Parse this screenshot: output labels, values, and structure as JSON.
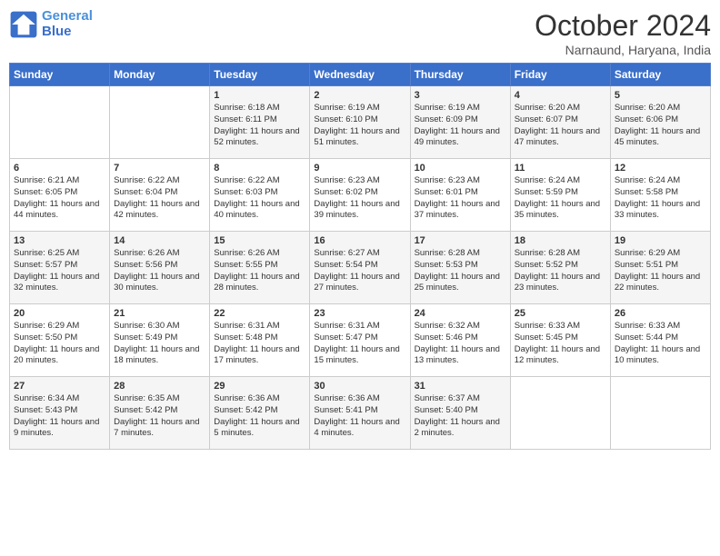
{
  "header": {
    "logo_line1": "General",
    "logo_line2": "Blue",
    "month": "October 2024",
    "location": "Narnaund, Haryana, India"
  },
  "days_of_week": [
    "Sunday",
    "Monday",
    "Tuesday",
    "Wednesday",
    "Thursday",
    "Friday",
    "Saturday"
  ],
  "weeks": [
    [
      {
        "day": "",
        "sunrise": "",
        "sunset": "",
        "daylight": ""
      },
      {
        "day": "",
        "sunrise": "",
        "sunset": "",
        "daylight": ""
      },
      {
        "day": "1",
        "sunrise": "Sunrise: 6:18 AM",
        "sunset": "Sunset: 6:11 PM",
        "daylight": "Daylight: 11 hours and 52 minutes."
      },
      {
        "day": "2",
        "sunrise": "Sunrise: 6:19 AM",
        "sunset": "Sunset: 6:10 PM",
        "daylight": "Daylight: 11 hours and 51 minutes."
      },
      {
        "day": "3",
        "sunrise": "Sunrise: 6:19 AM",
        "sunset": "Sunset: 6:09 PM",
        "daylight": "Daylight: 11 hours and 49 minutes."
      },
      {
        "day": "4",
        "sunrise": "Sunrise: 6:20 AM",
        "sunset": "Sunset: 6:07 PM",
        "daylight": "Daylight: 11 hours and 47 minutes."
      },
      {
        "day": "5",
        "sunrise": "Sunrise: 6:20 AM",
        "sunset": "Sunset: 6:06 PM",
        "daylight": "Daylight: 11 hours and 45 minutes."
      }
    ],
    [
      {
        "day": "6",
        "sunrise": "Sunrise: 6:21 AM",
        "sunset": "Sunset: 6:05 PM",
        "daylight": "Daylight: 11 hours and 44 minutes."
      },
      {
        "day": "7",
        "sunrise": "Sunrise: 6:22 AM",
        "sunset": "Sunset: 6:04 PM",
        "daylight": "Daylight: 11 hours and 42 minutes."
      },
      {
        "day": "8",
        "sunrise": "Sunrise: 6:22 AM",
        "sunset": "Sunset: 6:03 PM",
        "daylight": "Daylight: 11 hours and 40 minutes."
      },
      {
        "day": "9",
        "sunrise": "Sunrise: 6:23 AM",
        "sunset": "Sunset: 6:02 PM",
        "daylight": "Daylight: 11 hours and 39 minutes."
      },
      {
        "day": "10",
        "sunrise": "Sunrise: 6:23 AM",
        "sunset": "Sunset: 6:01 PM",
        "daylight": "Daylight: 11 hours and 37 minutes."
      },
      {
        "day": "11",
        "sunrise": "Sunrise: 6:24 AM",
        "sunset": "Sunset: 5:59 PM",
        "daylight": "Daylight: 11 hours and 35 minutes."
      },
      {
        "day": "12",
        "sunrise": "Sunrise: 6:24 AM",
        "sunset": "Sunset: 5:58 PM",
        "daylight": "Daylight: 11 hours and 33 minutes."
      }
    ],
    [
      {
        "day": "13",
        "sunrise": "Sunrise: 6:25 AM",
        "sunset": "Sunset: 5:57 PM",
        "daylight": "Daylight: 11 hours and 32 minutes."
      },
      {
        "day": "14",
        "sunrise": "Sunrise: 6:26 AM",
        "sunset": "Sunset: 5:56 PM",
        "daylight": "Daylight: 11 hours and 30 minutes."
      },
      {
        "day": "15",
        "sunrise": "Sunrise: 6:26 AM",
        "sunset": "Sunset: 5:55 PM",
        "daylight": "Daylight: 11 hours and 28 minutes."
      },
      {
        "day": "16",
        "sunrise": "Sunrise: 6:27 AM",
        "sunset": "Sunset: 5:54 PM",
        "daylight": "Daylight: 11 hours and 27 minutes."
      },
      {
        "day": "17",
        "sunrise": "Sunrise: 6:28 AM",
        "sunset": "Sunset: 5:53 PM",
        "daylight": "Daylight: 11 hours and 25 minutes."
      },
      {
        "day": "18",
        "sunrise": "Sunrise: 6:28 AM",
        "sunset": "Sunset: 5:52 PM",
        "daylight": "Daylight: 11 hours and 23 minutes."
      },
      {
        "day": "19",
        "sunrise": "Sunrise: 6:29 AM",
        "sunset": "Sunset: 5:51 PM",
        "daylight": "Daylight: 11 hours and 22 minutes."
      }
    ],
    [
      {
        "day": "20",
        "sunrise": "Sunrise: 6:29 AM",
        "sunset": "Sunset: 5:50 PM",
        "daylight": "Daylight: 11 hours and 20 minutes."
      },
      {
        "day": "21",
        "sunrise": "Sunrise: 6:30 AM",
        "sunset": "Sunset: 5:49 PM",
        "daylight": "Daylight: 11 hours and 18 minutes."
      },
      {
        "day": "22",
        "sunrise": "Sunrise: 6:31 AM",
        "sunset": "Sunset: 5:48 PM",
        "daylight": "Daylight: 11 hours and 17 minutes."
      },
      {
        "day": "23",
        "sunrise": "Sunrise: 6:31 AM",
        "sunset": "Sunset: 5:47 PM",
        "daylight": "Daylight: 11 hours and 15 minutes."
      },
      {
        "day": "24",
        "sunrise": "Sunrise: 6:32 AM",
        "sunset": "Sunset: 5:46 PM",
        "daylight": "Daylight: 11 hours and 13 minutes."
      },
      {
        "day": "25",
        "sunrise": "Sunrise: 6:33 AM",
        "sunset": "Sunset: 5:45 PM",
        "daylight": "Daylight: 11 hours and 12 minutes."
      },
      {
        "day": "26",
        "sunrise": "Sunrise: 6:33 AM",
        "sunset": "Sunset: 5:44 PM",
        "daylight": "Daylight: 11 hours and 10 minutes."
      }
    ],
    [
      {
        "day": "27",
        "sunrise": "Sunrise: 6:34 AM",
        "sunset": "Sunset: 5:43 PM",
        "daylight": "Daylight: 11 hours and 9 minutes."
      },
      {
        "day": "28",
        "sunrise": "Sunrise: 6:35 AM",
        "sunset": "Sunset: 5:42 PM",
        "daylight": "Daylight: 11 hours and 7 minutes."
      },
      {
        "day": "29",
        "sunrise": "Sunrise: 6:36 AM",
        "sunset": "Sunset: 5:42 PM",
        "daylight": "Daylight: 11 hours and 5 minutes."
      },
      {
        "day": "30",
        "sunrise": "Sunrise: 6:36 AM",
        "sunset": "Sunset: 5:41 PM",
        "daylight": "Daylight: 11 hours and 4 minutes."
      },
      {
        "day": "31",
        "sunrise": "Sunrise: 6:37 AM",
        "sunset": "Sunset: 5:40 PM",
        "daylight": "Daylight: 11 hours and 2 minutes."
      },
      {
        "day": "",
        "sunrise": "",
        "sunset": "",
        "daylight": ""
      },
      {
        "day": "",
        "sunrise": "",
        "sunset": "",
        "daylight": ""
      }
    ]
  ]
}
